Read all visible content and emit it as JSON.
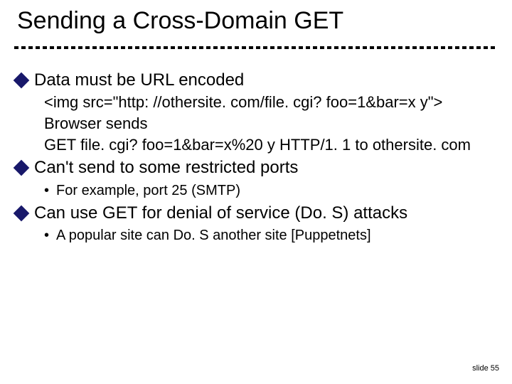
{
  "title": "Sending a Cross-Domain GET",
  "bullets": [
    {
      "text": "Data must be URL encoded",
      "subs": [
        "<img src=\"http: //othersite. com/file. cgi? foo=1&bar=x y\">",
        "Browser sends",
        "GET file. cgi? foo=1&bar=x%20 y HTTP/1. 1 to othersite. com"
      ]
    },
    {
      "text": "Can't send to some restricted ports",
      "dots": [
        "For example, port 25 (SMTP)"
      ]
    },
    {
      "text": "Can use GET for denial of service (Do. S) attacks",
      "dots": [
        "A popular site can Do. S another site  [Puppetnets]"
      ]
    }
  ],
  "footer": "slide 55"
}
